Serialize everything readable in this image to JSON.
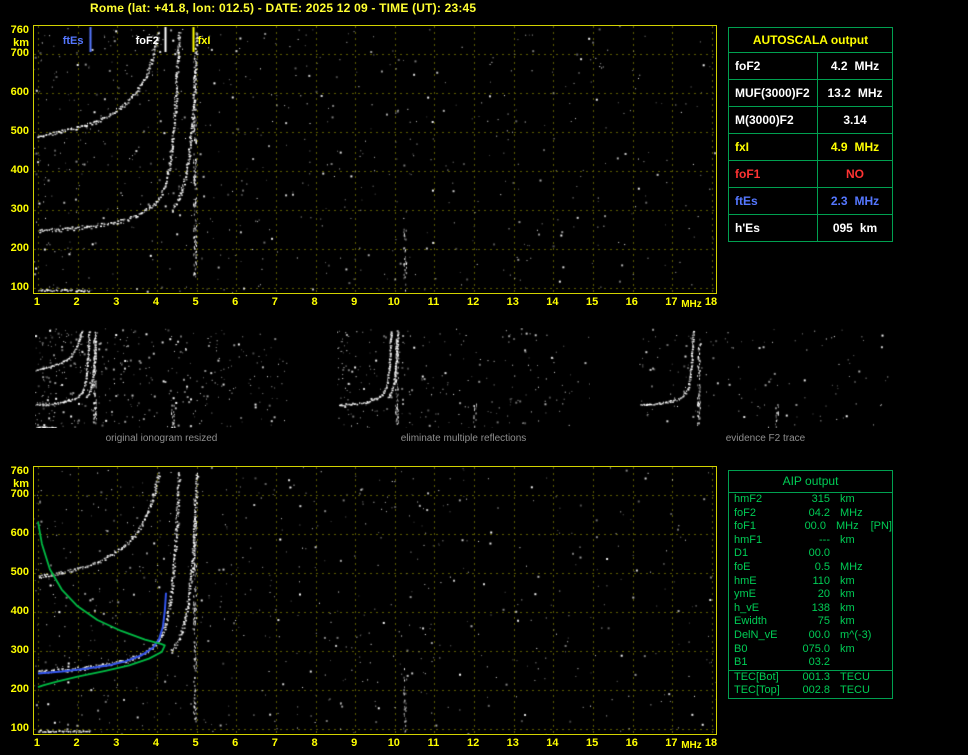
{
  "title": "Rome (lat: +41.8, lon: 012.5) - DATE: 2025 12 09 - TIME (UT): 23:45",
  "colors": {
    "background": "#000000",
    "axis_text": "#ffff00",
    "plot_border": "#d2d200",
    "grid": "#5c5c00",
    "table_border": "#00a050",
    "aip_text": "#00cc55",
    "caption": "#8f8f8f",
    "title": "#ffff33",
    "ftEs_blue": "#5577ff",
    "foF1_red": "#ff3333",
    "fxI_yellow": "#ffff00",
    "profile_green": "#00bb44",
    "fitted_blue": "#3355ee"
  },
  "autoscala_table": {
    "header": "AUTOSCALA output",
    "rows": [
      {
        "label": "foF2",
        "value": "4.2",
        "unit": "MHz",
        "color": "#ffffff"
      },
      {
        "label": "MUF(3000)F2",
        "value": "13.2",
        "unit": "MHz",
        "color": "#ffffff"
      },
      {
        "label": "M(3000)F2",
        "value": "3.14",
        "unit": "",
        "color": "#ffffff"
      },
      {
        "label": "fxI",
        "value": "4.9",
        "unit": "MHz",
        "color": "#ffff00"
      },
      {
        "label": "foF1",
        "value": "NO",
        "unit": "",
        "color": "#ff3333"
      },
      {
        "label": "ftEs",
        "value": "2.3",
        "unit": "MHz",
        "color": "#5577ff"
      },
      {
        "label": "h'Es",
        "value": "095",
        "unit": "km",
        "color": "#ffffff"
      }
    ]
  },
  "aip_table": {
    "header": "AIP output",
    "rows": [
      {
        "label": "hmF2",
        "value": "315",
        "unit": "km"
      },
      {
        "label": "foF2",
        "value": "04.2",
        "unit": "MHz"
      },
      {
        "label": "foF1",
        "value": "00.0",
        "unit": "MHz",
        "note": "[PN]"
      },
      {
        "label": "hmF1",
        "value": "---",
        "unit": "km"
      },
      {
        "label": "D1",
        "value": "00.0",
        "unit": ""
      },
      {
        "label": "foE",
        "value": "0.5",
        "unit": "MHz"
      },
      {
        "label": "hmE",
        "value": "110",
        "unit": "km"
      },
      {
        "label": "ymE",
        "value": "20",
        "unit": "km"
      },
      {
        "label": "h_vE",
        "value": "138",
        "unit": "km"
      },
      {
        "label": "Ewidth",
        "value": "75",
        "unit": "km"
      },
      {
        "label": "DelN_vE",
        "value": "00.0",
        "unit": "m^(-3)"
      },
      {
        "label": "B0",
        "value": "075.0",
        "unit": "km"
      },
      {
        "label": "B1",
        "value": "03.2",
        "unit": ""
      },
      {
        "label": "TEC[Bot]",
        "value": "001.3",
        "unit": "TECU",
        "separated": true
      },
      {
        "label": "TEC[Top]",
        "value": "002.8",
        "unit": "TECU"
      }
    ]
  },
  "thumbnails": [
    {
      "caption": "original ionogram resized",
      "noise": 420,
      "seed": 11,
      "traces": [
        "F2-ordinary",
        "F2-extraordinary",
        "second-hop",
        "Es"
      ]
    },
    {
      "caption": "eliminate multiple reflections",
      "noise": 260,
      "seed": 12,
      "traces": [
        "F2-ordinary",
        "F2-extraordinary"
      ]
    },
    {
      "caption": "evidence F2 trace",
      "noise": 140,
      "seed": 13,
      "traces": [
        "F2-ordinary"
      ]
    }
  ],
  "chart_data": [
    {
      "id": "ionogram_top",
      "type": "scatter",
      "title": "scaled ionogram",
      "xlabel": "MHz",
      "ylabel": "km",
      "xlim": [
        0.9,
        18.1
      ],
      "ylim": [
        88,
        772
      ],
      "grid": true,
      "x_ticks": [
        1,
        2,
        3,
        4,
        5,
        6,
        7,
        8,
        9,
        10,
        11,
        12,
        13,
        14,
        15,
        16,
        17,
        18
      ],
      "y_ticks": [
        760,
        700,
        600,
        500,
        400,
        300,
        200,
        100
      ],
      "scaled_values": {
        "foF2_MHz": 4.2,
        "MUF3000F2_MHz": 13.2,
        "M3000F2": 3.14,
        "fxI_MHz": 4.9,
        "foF1": "NO",
        "ftEs_MHz": 2.3,
        "hEs_km": 95
      },
      "markers": [
        {
          "label": "ftEs",
          "freq": 2.3,
          "color": "#5577ff",
          "side": "left"
        },
        {
          "label": "foF2",
          "freq": 4.2,
          "color": "#ffffff",
          "side": "left"
        },
        {
          "label": "fxI",
          "freq": 4.9,
          "color": "#ffff00",
          "side": "right"
        }
      ],
      "traces": [
        {
          "name": "F2-ordinary",
          "color": "#ffffff",
          "thick": 4,
          "points": [
            [
              1.0,
              248
            ],
            [
              1.6,
              252
            ],
            [
              2.2,
              258
            ],
            [
              2.8,
              267
            ],
            [
              3.2,
              277
            ],
            [
              3.6,
              292
            ],
            [
              3.9,
              313
            ],
            [
              4.1,
              340
            ],
            [
              4.25,
              382
            ],
            [
              4.35,
              450
            ],
            [
              4.45,
              560
            ],
            [
              4.5,
              660
            ],
            [
              4.55,
              760
            ]
          ]
        },
        {
          "name": "F2-extraordinary",
          "color": "#ffffff",
          "thick": 3,
          "points": [
            [
              4.35,
              300
            ],
            [
              4.55,
              332
            ],
            [
              4.7,
              382
            ],
            [
              4.8,
              445
            ],
            [
              4.9,
              545
            ],
            [
              4.95,
              655
            ],
            [
              5.0,
              760
            ]
          ]
        },
        {
          "name": "second-hop",
          "color": "#ffffff",
          "thick": 3,
          "points": [
            [
              1.0,
              492
            ],
            [
              1.5,
              501
            ],
            [
              2.0,
              513
            ],
            [
              2.5,
              529
            ],
            [
              2.9,
              551
            ],
            [
              3.3,
              582
            ],
            [
              3.6,
              622
            ],
            [
              3.8,
              666
            ],
            [
              3.95,
              722
            ],
            [
              4.05,
              760
            ]
          ]
        },
        {
          "name": "Es",
          "color": "#ffffff",
          "thick": 2,
          "points": [
            [
              1.0,
              97
            ],
            [
              2.3,
              95
            ]
          ]
        }
      ],
      "stripes": [
        {
          "freq": 4.95,
          "h_range": [
            120,
            700
          ],
          "count": 160
        },
        {
          "freq": 10.25,
          "h_range": [
            95,
            260
          ],
          "count": 30
        }
      ],
      "noise": {
        "count": 650,
        "seed": 7
      }
    },
    {
      "id": "ionogram_bottom",
      "type": "scatter",
      "title": "ionogram with AIP profile",
      "xlabel": "MHz",
      "ylabel": "km",
      "xlim": [
        0.9,
        18.1
      ],
      "ylim": [
        88,
        772
      ],
      "grid": true,
      "x_ticks": [
        1,
        2,
        3,
        4,
        5,
        6,
        7,
        8,
        9,
        10,
        11,
        12,
        13,
        14,
        15,
        16,
        17,
        18
      ],
      "y_ticks": [
        760,
        700,
        600,
        500,
        400,
        300,
        200,
        100
      ],
      "markers": [],
      "traces": [
        {
          "name": "F2-ordinary",
          "color": "#ffffff",
          "thick": 4,
          "points": [
            [
              1.0,
              248
            ],
            [
              1.6,
              252
            ],
            [
              2.2,
              258
            ],
            [
              2.8,
              267
            ],
            [
              3.2,
              277
            ],
            [
              3.6,
              292
            ],
            [
              3.9,
              313
            ],
            [
              4.1,
              340
            ],
            [
              4.25,
              382
            ],
            [
              4.35,
              450
            ],
            [
              4.45,
              560
            ],
            [
              4.5,
              660
            ],
            [
              4.55,
              760
            ]
          ]
        },
        {
          "name": "F2-extraordinary",
          "color": "#ffffff",
          "thick": 3,
          "points": [
            [
              4.35,
              300
            ],
            [
              4.55,
              332
            ],
            [
              4.7,
              382
            ],
            [
              4.8,
              445
            ],
            [
              4.9,
              545
            ],
            [
              4.95,
              655
            ],
            [
              5.0,
              760
            ]
          ]
        },
        {
          "name": "second-hop",
          "color": "#ffffff",
          "thick": 3,
          "points": [
            [
              1.0,
              492
            ],
            [
              1.5,
              501
            ],
            [
              2.0,
              513
            ],
            [
              2.5,
              529
            ],
            [
              2.9,
              551
            ],
            [
              3.3,
              582
            ],
            [
              3.6,
              622
            ],
            [
              3.8,
              666
            ],
            [
              3.95,
              722
            ],
            [
              4.05,
              760
            ]
          ]
        },
        {
          "name": "Es",
          "color": "#ffffff",
          "thick": 2,
          "points": [
            [
              1.0,
              97
            ],
            [
              2.3,
              95
            ]
          ]
        }
      ],
      "stripes": [
        {
          "freq": 4.95,
          "h_range": [
            120,
            700
          ],
          "count": 160
        },
        {
          "freq": 10.25,
          "h_range": [
            95,
            260
          ],
          "count": 30
        }
      ],
      "overlays": [
        {
          "name": "fitted-F2-trace",
          "color": "#3355ee",
          "width": 2,
          "points": [
            [
              1.0,
              243
            ],
            [
              1.6,
              248
            ],
            [
              2.2,
              255
            ],
            [
              2.8,
              264
            ],
            [
              3.2,
              274
            ],
            [
              3.6,
              289
            ],
            [
              3.9,
              309
            ],
            [
              4.05,
              330
            ],
            [
              4.15,
              362
            ],
            [
              4.2,
              405
            ],
            [
              4.23,
              450
            ]
          ]
        },
        {
          "name": "electron-density-profile",
          "color": "#00bb44",
          "width": 1.8,
          "points": [
            [
              1.0,
              632
            ],
            [
              1.1,
              575
            ],
            [
              1.3,
              510
            ],
            [
              1.6,
              458
            ],
            [
              2.0,
              415
            ],
            [
              2.5,
              380
            ],
            [
              3.1,
              352
            ],
            [
              3.7,
              330
            ],
            [
              4.1,
              319
            ],
            [
              4.2,
              315
            ],
            [
              4.12,
              298
            ],
            [
              3.8,
              281
            ],
            [
              3.3,
              264
            ],
            [
              2.7,
              250
            ],
            [
              2.0,
              235
            ],
            [
              1.5,
              223
            ],
            [
              1.15,
              213
            ],
            [
              1.0,
              208
            ]
          ]
        }
      ],
      "noise": {
        "count": 650,
        "seed": 21
      }
    }
  ]
}
